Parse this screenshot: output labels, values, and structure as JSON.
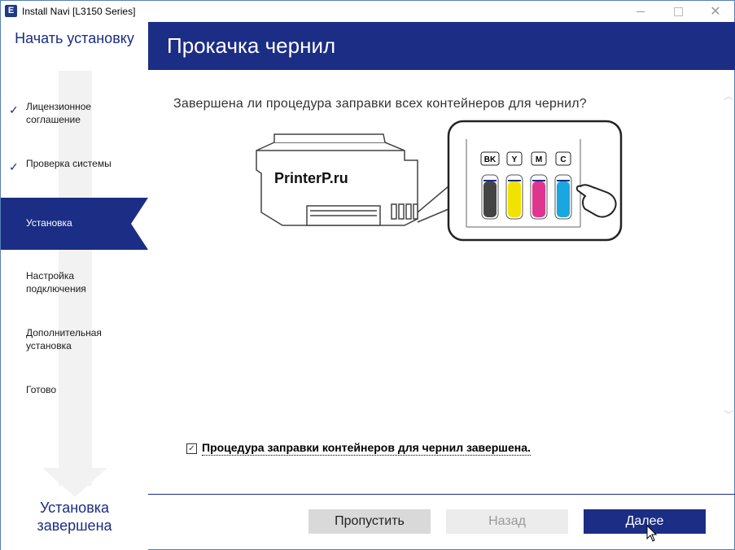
{
  "window": {
    "title": "Install Navi [L3150 Series]",
    "app_icon": "E"
  },
  "sidebar": {
    "top_label": "Начать установку",
    "steps": [
      {
        "label": "Лицензионное\nсоглашение",
        "done": true
      },
      {
        "label": "Проверка системы",
        "done": true
      },
      {
        "label": "Установка",
        "active": true
      },
      {
        "label": "Настройка\nподключения"
      },
      {
        "label": "Дополнительная\nустановка"
      },
      {
        "label": "Готово"
      }
    ],
    "bottom_label_1": "Установка",
    "bottom_label_2": "завершена"
  },
  "header": {
    "title": "Прокачка чернил"
  },
  "content": {
    "question": "Завершена ли процедура заправки всех контейнеров для чернил?",
    "watermark": "PrinterP.ru",
    "ink_labels": [
      "BK",
      "Y",
      "M",
      "C"
    ],
    "checkbox_label": "Процедура заправки контейнеров для чернил завершена.",
    "checkbox_checked": true
  },
  "buttons": {
    "skip": "Пропустить",
    "back": "Назад",
    "next": "Далее"
  },
  "colors": {
    "accent": "#1b2d84",
    "bk": "#333333",
    "y": "#f2e200",
    "m": "#e0358f",
    "c": "#1aa7e0"
  }
}
